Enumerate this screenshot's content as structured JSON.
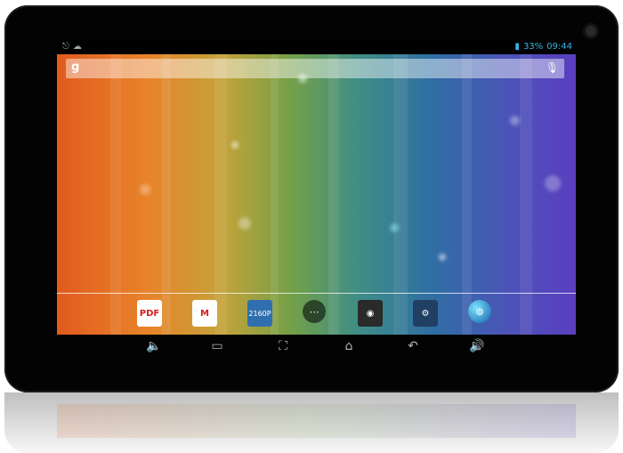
{
  "status": {
    "battery_text": "33%",
    "time": "09:44",
    "left_icons": [
      "usb-icon",
      "android-icon"
    ]
  },
  "search": {
    "google_letter": "g",
    "icons": [
      "google-search-icon",
      "mic-icon"
    ]
  },
  "dock": {
    "apps": [
      {
        "name": "pdf-reader-icon",
        "label": "PDF"
      },
      {
        "name": "gmail-icon",
        "label": "M"
      },
      {
        "name": "video-2160p-icon",
        "label": "2160P"
      },
      {
        "name": "all-apps-icon",
        "label": "⋯"
      },
      {
        "name": "camera-icon",
        "label": ""
      },
      {
        "name": "settings-icon",
        "label": ""
      },
      {
        "name": "browser-globe-icon",
        "label": ""
      }
    ]
  },
  "nav": {
    "buttons": [
      "volume-down-icon",
      "recent-apps-icon",
      "screenshot-icon",
      "home-icon",
      "back-icon",
      "volume-up-icon"
    ]
  },
  "colors": {
    "accent": "#33b5e5"
  }
}
